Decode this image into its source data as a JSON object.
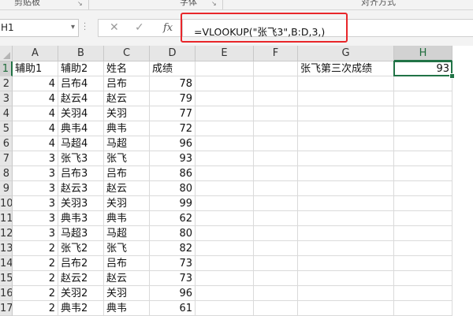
{
  "ribbon": {
    "groups": [
      "剪贴板",
      "字体",
      "对齐方式"
    ]
  },
  "formula_bar": {
    "name_box": "H1",
    "cancel_icon": "✕",
    "enter_icon": "✓",
    "fx_label": "fx",
    "formula": "=VLOOKUP(\"张飞3\",B:D,3,)",
    "highlight_color": "#e8262a"
  },
  "sheet": {
    "columns": [
      "A",
      "B",
      "C",
      "D",
      "E",
      "F",
      "G",
      "H"
    ],
    "selected_cell": "H1",
    "row_numbers": [
      "1",
      "2",
      "3",
      "4",
      "5",
      "6",
      "7",
      "8",
      "9",
      "10",
      "11",
      "12",
      "13",
      "14",
      "15",
      "16",
      "17"
    ],
    "header_row": [
      "辅助1",
      "辅助2",
      "姓名",
      "成绩"
    ],
    "rows": [
      [
        "4",
        "吕布4",
        "吕布",
        "78"
      ],
      [
        "4",
        "赵云4",
        "赵云",
        "79"
      ],
      [
        "4",
        "关羽4",
        "关羽",
        "77"
      ],
      [
        "4",
        "典韦4",
        "典韦",
        "72"
      ],
      [
        "4",
        "马超4",
        "马超",
        "96"
      ],
      [
        "3",
        "张飞3",
        "张飞",
        "93"
      ],
      [
        "3",
        "吕布3",
        "吕布",
        "86"
      ],
      [
        "3",
        "赵云3",
        "赵云",
        "80"
      ],
      [
        "3",
        "关羽3",
        "关羽",
        "99"
      ],
      [
        "3",
        "典韦3",
        "典韦",
        "62"
      ],
      [
        "3",
        "马超3",
        "马超",
        "80"
      ],
      [
        "2",
        "张飞2",
        "张飞",
        "82"
      ],
      [
        "2",
        "吕布2",
        "吕布",
        "73"
      ],
      [
        "2",
        "赵云2",
        "赵云",
        "73"
      ],
      [
        "2",
        "关羽2",
        "关羽",
        "96"
      ],
      [
        "2",
        "典韦2",
        "典韦",
        "61"
      ]
    ],
    "g1_label": "张飞第三次成绩",
    "h1_value": "93",
    "accent_color": "#217346"
  }
}
